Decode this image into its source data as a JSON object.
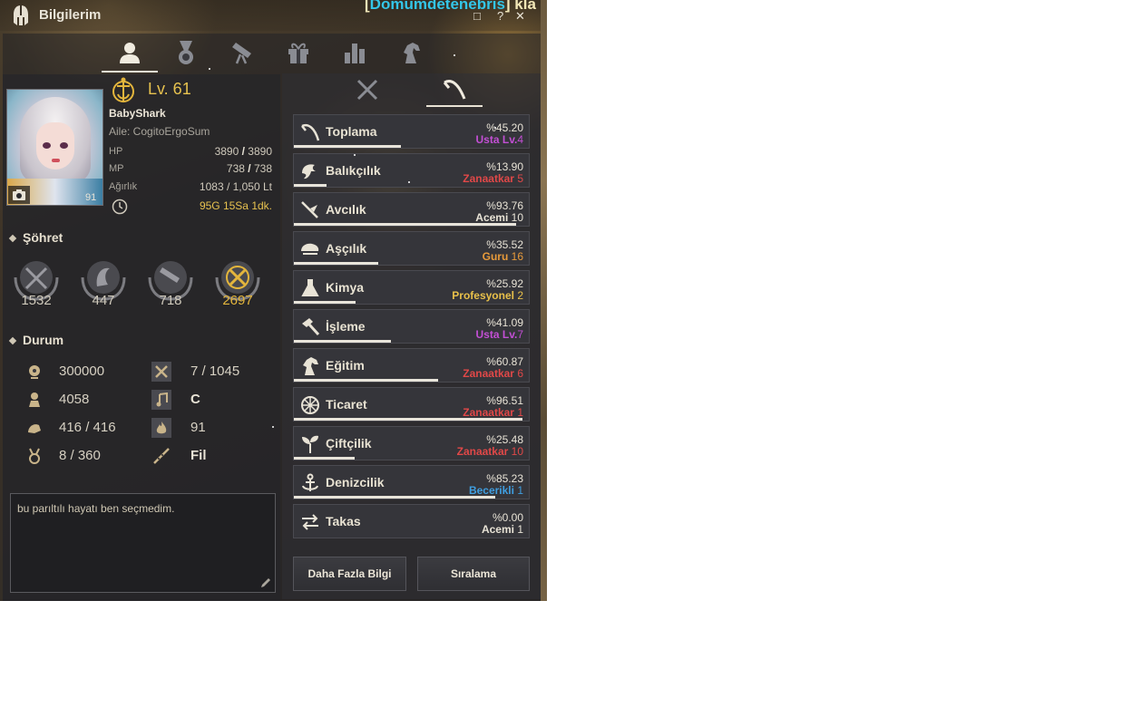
{
  "window": {
    "title": "Bilgilerim",
    "clan_prefix": "[",
    "clan_name": "Domumdetenebris",
    "clan_suffix": "] kla",
    "controls": [
      "□",
      "?",
      "✕"
    ]
  },
  "tabs": [
    {
      "icon": "person-icon",
      "active": true
    },
    {
      "icon": "medal-icon",
      "active": false
    },
    {
      "icon": "telescope-icon",
      "active": false
    },
    {
      "icon": "gift-icon",
      "active": false
    },
    {
      "icon": "bar-chart-icon",
      "active": false
    },
    {
      "icon": "horse-icon",
      "active": false
    }
  ],
  "character": {
    "level": "Lv. 61",
    "name": "BabyShark",
    "family": "Aile: CogitoErgoSum",
    "portrait_level": "91",
    "hp_label": "HP",
    "hp_current": "3890",
    "hp_sep": " / ",
    "hp_max": "3890",
    "mp_label": "MP",
    "mp_current": "738",
    "mp_sep": " / ",
    "mp_max": "738",
    "weight_label": "Ağırlık",
    "weight_value": "1083 / 1,050 Lt",
    "time_value": "95G 15Sa 1dk."
  },
  "fame": {
    "heading": "Şöhret",
    "items": [
      {
        "icon": "combat-fame-icon",
        "value": "1532",
        "gold": false
      },
      {
        "icon": "life-fame-icon",
        "value": "447",
        "gold": false
      },
      {
        "icon": "explore-fame-icon",
        "value": "718",
        "gold": false
      },
      {
        "icon": "total-fame-icon",
        "value": "2697",
        "gold": true
      }
    ]
  },
  "status": {
    "heading": "Durum",
    "items": [
      {
        "icon": "contribution-icon",
        "value": "300000",
        "bold": false
      },
      {
        "icon": "tools-icon",
        "value": "7 / 1045",
        "bold": false
      },
      {
        "icon": "energy-icon",
        "value": "4058",
        "bold": false
      },
      {
        "icon": "music-icon",
        "value": "C",
        "bold": true
      },
      {
        "icon": "stamina-icon",
        "value": "416 / 416",
        "bold": false
      },
      {
        "icon": "fire-icon",
        "value": "91",
        "bold": false
      },
      {
        "icon": "trophy-icon",
        "value": "8 / 360",
        "bold": false
      },
      {
        "icon": "flute-icon",
        "value": "Fil",
        "bold": true
      }
    ]
  },
  "memo": {
    "text": "bu parıltılı hayatı ben seçmedim."
  },
  "subtabs": [
    {
      "icon": "crossed-swords-icon",
      "active": false
    },
    {
      "icon": "sickle-icon",
      "active": true
    }
  ],
  "lifeskills": [
    {
      "icon": "sickle-icon",
      "name": "Toplama",
      "percent": "%45.20",
      "rank": "Usta Lv.",
      "level": "4",
      "color": "#c24fd4",
      "progress": 0.452
    },
    {
      "icon": "fish-icon",
      "name": "Balıkçılık",
      "percent": "%13.90",
      "rank": "Zanaatkar ",
      "level": "5",
      "color": "#e04848",
      "progress": 0.139
    },
    {
      "icon": "hunting-icon",
      "name": "Avcılık",
      "percent": "%93.76",
      "rank": "Acemi ",
      "level": "10",
      "color": "#e8e3d6",
      "progress": 0.9376
    },
    {
      "icon": "cooking-icon",
      "name": "Aşçılık",
      "percent": "%35.52",
      "rank": "Guru ",
      "level": "16",
      "color": "#e79a3a",
      "progress": 0.3552
    },
    {
      "icon": "flask-icon",
      "name": "Kimya",
      "percent": "%25.92",
      "rank": "Profesyonel ",
      "level": "2",
      "color": "#e8c04a",
      "progress": 0.2592
    },
    {
      "icon": "hammer-icon",
      "name": "İşleme",
      "percent": "%41.09",
      "rank": "Usta Lv.",
      "level": "7",
      "color": "#c24fd4",
      "progress": 0.4109
    },
    {
      "icon": "horse-icon",
      "name": "Eğitim",
      "percent": "%60.87",
      "rank": "Zanaatkar ",
      "level": "6",
      "color": "#e04848",
      "progress": 0.6087
    },
    {
      "icon": "wheel-icon",
      "name": "Ticaret",
      "percent": "%96.51",
      "rank": "Zanaatkar ",
      "level": "1",
      "color": "#e04848",
      "progress": 0.9651
    },
    {
      "icon": "sprout-icon",
      "name": "Çiftçilik",
      "percent": "%25.48",
      "rank": "Zanaatkar ",
      "level": "10",
      "color": "#e04848",
      "progress": 0.2548
    },
    {
      "icon": "anchor-icon",
      "name": "Denizcilik",
      "percent": "%85.23",
      "rank": "Becerikli ",
      "level": "1",
      "color": "#3f9ee0",
      "progress": 0.8523
    },
    {
      "icon": "exchange-icon",
      "name": "Takas",
      "percent": "%0.00",
      "rank": "Acemi ",
      "level": "1",
      "color": "#e8e3d6",
      "progress": 0
    }
  ],
  "buttons": {
    "more_info": "Daha Fazla Bilgi",
    "ranking": "Sıralama"
  }
}
